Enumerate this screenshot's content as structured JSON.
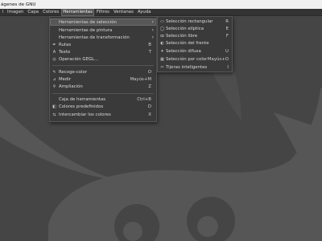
{
  "window": {
    "title": "ágenes de GNU"
  },
  "menubar": {
    "items": [
      {
        "label": "l",
        "active": false
      },
      {
        "label": "Imagen",
        "active": false
      },
      {
        "label": "Capa",
        "active": false
      },
      {
        "label": "Colores",
        "active": false
      },
      {
        "label": "Herramientas",
        "active": true
      },
      {
        "label": "Filtros",
        "active": false
      },
      {
        "label": "Ventanas",
        "active": false
      },
      {
        "label": "Ayuda",
        "active": false
      }
    ]
  },
  "tools_menu": {
    "items": [
      {
        "label": "Herramientas de selección",
        "shortcut": "",
        "submenu": true,
        "icon": "none",
        "highlighted": true
      },
      {
        "label": "Herramientas de pintura",
        "shortcut": "",
        "submenu": true,
        "icon": "none"
      },
      {
        "label": "Herramientas de transformación",
        "shortcut": "",
        "submenu": true,
        "icon": "none"
      },
      {
        "label": "Rutas",
        "shortcut": "B",
        "submenu": false,
        "icon": "paths-icon"
      },
      {
        "label": "Texto",
        "shortcut": "T",
        "submenu": false,
        "icon": "text-tool-icon"
      },
      {
        "label": "Operación GEGL...",
        "shortcut": "",
        "submenu": false,
        "icon": "gegl-icon"
      },
      {
        "label": "Recoge-color",
        "shortcut": "O",
        "submenu": false,
        "icon": "color-picker-icon"
      },
      {
        "label": "Medir",
        "shortcut": "Mayús+M",
        "submenu": false,
        "icon": "measure-icon"
      },
      {
        "label": "Ampliación",
        "shortcut": "Z",
        "submenu": false,
        "icon": "zoom-icon"
      },
      {
        "label": "Caja de herramientas",
        "shortcut": "Ctrl+B",
        "submenu": false,
        "icon": "none"
      },
      {
        "label": "Colores predefinidos",
        "shortcut": "D",
        "submenu": false,
        "icon": "default-colors-icon"
      },
      {
        "label": "Intercambiar los colores",
        "shortcut": "X",
        "submenu": false,
        "icon": "swap-colors-icon"
      }
    ]
  },
  "selection_submenu": {
    "items": [
      {
        "label": "Selección rectangular",
        "shortcut": "R",
        "icon": "rect-select-icon"
      },
      {
        "label": "Selección elíptica",
        "shortcut": "E",
        "icon": "ellipse-select-icon"
      },
      {
        "label": "Selección libre",
        "shortcut": "F",
        "icon": "free-select-icon"
      },
      {
        "label": "Selección del frente",
        "shortcut": "",
        "icon": "foreground-select-icon"
      },
      {
        "label": "Selección difusa",
        "shortcut": "U",
        "icon": "fuzzy-select-icon"
      },
      {
        "label": "Selección por color",
        "shortcut": "Mayús+O",
        "icon": "select-by-color-icon"
      },
      {
        "label": "Tijeras inteligentes",
        "shortcut": "I",
        "icon": "scissors-icon"
      }
    ]
  },
  "icons": {
    "arrow": "›",
    "paths-icon": "✒",
    "text-tool-icon": "A",
    "gegl-icon": "◎",
    "color-picker-icon": "✎",
    "measure-icon": "⊿",
    "zoom-icon": "⚲",
    "default-colors-icon": "◧",
    "swap-colors-icon": "⇆",
    "rect-select-icon": "▭",
    "ellipse-select-icon": "◯",
    "free-select-icon": "ꝏ",
    "foreground-select-icon": "◐",
    "fuzzy-select-icon": "✦",
    "select-by-color-icon": "▦",
    "scissors-icon": "✂"
  },
  "colors": {
    "background": "#454545",
    "menu_bg": "#3a3a3a",
    "highlight": "#575757",
    "watermark": "#565656"
  }
}
